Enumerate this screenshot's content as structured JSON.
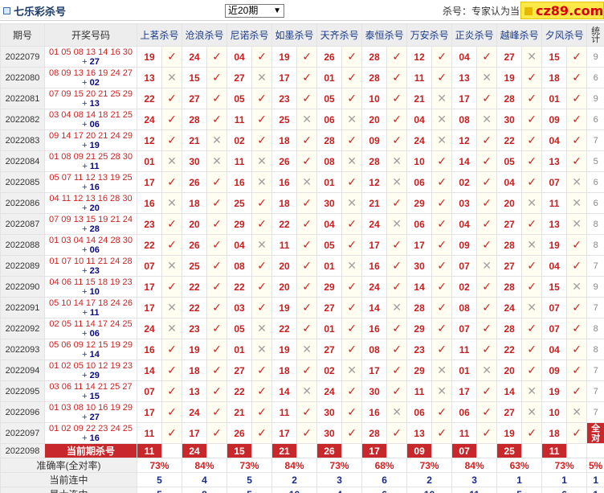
{
  "header": {
    "title": "七乐彩杀号",
    "period_select": "近20期",
    "kill_label": "杀号：专家认为当",
    "logo_text": "cz89.com"
  },
  "columns": {
    "issue": "期号",
    "draw": "开奖号码",
    "sites": [
      "上茗杀号",
      "沧浪杀号",
      "尼诺杀号",
      "如墨杀号",
      "天齐杀号",
      "泰恒杀号",
      "万安杀号",
      "正炎杀号",
      "越峰杀号",
      "夕风杀号"
    ],
    "stat": "统计"
  },
  "rows": [
    {
      "issue": "2022079",
      "main": "01 05 08 13 14 16 30",
      "special": "27",
      "kills": [
        "19",
        "24",
        "04",
        "19",
        "26",
        "28",
        "12",
        "04",
        "27",
        "15"
      ],
      "hits": [
        1,
        1,
        1,
        1,
        1,
        1,
        1,
        1,
        0,
        1
      ],
      "stat": "9"
    },
    {
      "issue": "2022080",
      "main": "08 09 13 16 19 24 27",
      "special": "02",
      "kills": [
        "13",
        "15",
        "27",
        "17",
        "01",
        "28",
        "11",
        "13",
        "19",
        "18"
      ],
      "hits": [
        0,
        1,
        0,
        1,
        1,
        1,
        1,
        0,
        1,
        1
      ],
      "stat": "6"
    },
    {
      "issue": "2022081",
      "main": "07 09 15 20 21 25 29",
      "special": "13",
      "kills": [
        "22",
        "27",
        "05",
        "23",
        "05",
        "10",
        "21",
        "17",
        "28",
        "01"
      ],
      "hits": [
        1,
        1,
        1,
        1,
        1,
        1,
        0,
        1,
        1,
        1
      ],
      "stat": "9"
    },
    {
      "issue": "2022082",
      "main": "03 04 08 14 18 21 25",
      "special": "06",
      "kills": [
        "24",
        "28",
        "11",
        "25",
        "06",
        "20",
        "04",
        "08",
        "30",
        "09"
      ],
      "hits": [
        1,
        1,
        1,
        0,
        0,
        1,
        0,
        0,
        1,
        1
      ],
      "stat": "6"
    },
    {
      "issue": "2022083",
      "main": "09 14 17 20 21 24 29",
      "special": "19",
      "kills": [
        "12",
        "21",
        "02",
        "18",
        "28",
        "09",
        "24",
        "12",
        "22",
        "04"
      ],
      "hits": [
        1,
        0,
        1,
        1,
        1,
        1,
        0,
        1,
        1,
        1
      ],
      "stat": "7"
    },
    {
      "issue": "2022084",
      "main": "01 08 09 21 25 28 30",
      "special": "11",
      "kills": [
        "01",
        "30",
        "11",
        "26",
        "08",
        "28",
        "10",
        "14",
        "05",
        "13"
      ],
      "hits": [
        0,
        0,
        0,
        1,
        0,
        0,
        1,
        1,
        1,
        1
      ],
      "stat": "5"
    },
    {
      "issue": "2022085",
      "main": "05 07 11 12 13 19 25",
      "special": "16",
      "kills": [
        "17",
        "26",
        "16",
        "16",
        "01",
        "12",
        "06",
        "02",
        "04",
        "07"
      ],
      "hits": [
        1,
        1,
        0,
        0,
        1,
        0,
        1,
        1,
        1,
        0
      ],
      "stat": "6"
    },
    {
      "issue": "2022086",
      "main": "04 11 12 13 16 28 30",
      "special": "20",
      "kills": [
        "16",
        "18",
        "25",
        "18",
        "30",
        "21",
        "29",
        "03",
        "20",
        "11"
      ],
      "hits": [
        0,
        1,
        1,
        1,
        0,
        1,
        1,
        1,
        0,
        0
      ],
      "stat": "6"
    },
    {
      "issue": "2022087",
      "main": "07 09 13 15 19 21 24",
      "special": "28",
      "kills": [
        "23",
        "20",
        "29",
        "22",
        "04",
        "24",
        "06",
        "04",
        "27",
        "13"
      ],
      "hits": [
        1,
        1,
        1,
        1,
        1,
        0,
        1,
        1,
        1,
        0
      ],
      "stat": "8"
    },
    {
      "issue": "2022088",
      "main": "01 03 04 14 24 28 30",
      "special": "06",
      "kills": [
        "22",
        "26",
        "04",
        "11",
        "05",
        "17",
        "17",
        "09",
        "28",
        "19"
      ],
      "hits": [
        1,
        1,
        0,
        1,
        1,
        1,
        1,
        1,
        0,
        1
      ],
      "stat": "8"
    },
    {
      "issue": "2022089",
      "main": "01 07 10 11 21 24 28",
      "special": "23",
      "kills": [
        "07",
        "25",
        "08",
        "20",
        "01",
        "16",
        "30",
        "07",
        "27",
        "04"
      ],
      "hits": [
        0,
        1,
        1,
        1,
        0,
        1,
        1,
        0,
        1,
        1
      ],
      "stat": "7"
    },
    {
      "issue": "2022090",
      "main": "04 06 11 15 18 19 23",
      "special": "10",
      "kills": [
        "17",
        "22",
        "22",
        "20",
        "29",
        "24",
        "14",
        "02",
        "28",
        "15"
      ],
      "hits": [
        1,
        1,
        1,
        1,
        1,
        1,
        1,
        1,
        1,
        0
      ],
      "stat": "9"
    },
    {
      "issue": "2022091",
      "main": "05 10 14 17 18 24 26",
      "special": "11",
      "kills": [
        "17",
        "22",
        "03",
        "19",
        "27",
        "14",
        "28",
        "08",
        "24",
        "07"
      ],
      "hits": [
        0,
        1,
        1,
        1,
        1,
        0,
        1,
        1,
        0,
        1
      ],
      "stat": "7"
    },
    {
      "issue": "2022092",
      "main": "02 05 11 14 17 24 25",
      "special": "06",
      "kills": [
        "24",
        "23",
        "05",
        "22",
        "01",
        "16",
        "29",
        "07",
        "28",
        "07"
      ],
      "hits": [
        0,
        1,
        0,
        1,
        1,
        1,
        1,
        1,
        1,
        1
      ],
      "stat": "8"
    },
    {
      "issue": "2022093",
      "main": "05 06 09 12 15 19 29",
      "special": "14",
      "kills": [
        "16",
        "19",
        "01",
        "19",
        "27",
        "08",
        "23",
        "11",
        "22",
        "04"
      ],
      "hits": [
        1,
        1,
        0,
        0,
        1,
        1,
        1,
        1,
        1,
        1
      ],
      "stat": "8"
    },
    {
      "issue": "2022094",
      "main": "01 02 05 10 12 19 23",
      "special": "29",
      "kills": [
        "14",
        "18",
        "27",
        "18",
        "02",
        "17",
        "29",
        "01",
        "20",
        "09"
      ],
      "hits": [
        1,
        1,
        1,
        1,
        0,
        1,
        0,
        0,
        1,
        1
      ],
      "stat": "7"
    },
    {
      "issue": "2022095",
      "main": "03 06 11 14 21 25 27",
      "special": "15",
      "kills": [
        "07",
        "13",
        "22",
        "14",
        "24",
        "30",
        "11",
        "17",
        "14",
        "19"
      ],
      "hits": [
        1,
        1,
        1,
        0,
        1,
        1,
        0,
        1,
        0,
        1
      ],
      "stat": "7"
    },
    {
      "issue": "2022096",
      "main": "01 03 08 10 16 19 29",
      "special": "27",
      "kills": [
        "17",
        "24",
        "21",
        "11",
        "30",
        "16",
        "06",
        "06",
        "27",
        "10"
      ],
      "hits": [
        1,
        1,
        1,
        1,
        1,
        0,
        1,
        1,
        0,
        0
      ],
      "stat": "7"
    },
    {
      "issue": "2022097",
      "main": "01 02 09 22 23 24 25",
      "special": "16",
      "kills": [
        "11",
        "17",
        "26",
        "17",
        "30",
        "28",
        "13",
        "11",
        "19",
        "18"
      ],
      "hits": [
        1,
        1,
        1,
        1,
        1,
        1,
        1,
        1,
        1,
        1
      ],
      "stat": "全对"
    }
  ],
  "current": {
    "issue": "2022098",
    "label": "当前期杀号",
    "kills": [
      "11",
      "24",
      "15",
      "21",
      "26",
      "17",
      "09",
      "07",
      "25",
      "11"
    ]
  },
  "summary": {
    "accuracy_label": "准确率(全对率)",
    "accuracy": [
      "73%",
      "84%",
      "73%",
      "84%",
      "73%",
      "68%",
      "73%",
      "84%",
      "63%",
      "73%"
    ],
    "accuracy_all": "5%",
    "current_streak_label": "当前连中",
    "current_streak": [
      "5",
      "4",
      "5",
      "2",
      "3",
      "6",
      "2",
      "3",
      "1",
      "1"
    ],
    "current_streak_all": "1",
    "max_streak_label": "最大连中",
    "max_streak": [
      "5",
      "8",
      "5",
      "10",
      "4",
      "6",
      "10",
      "11",
      "5",
      "6"
    ],
    "max_streak_all": "1"
  },
  "marks": {
    "hit": "✓",
    "miss": "✕"
  }
}
